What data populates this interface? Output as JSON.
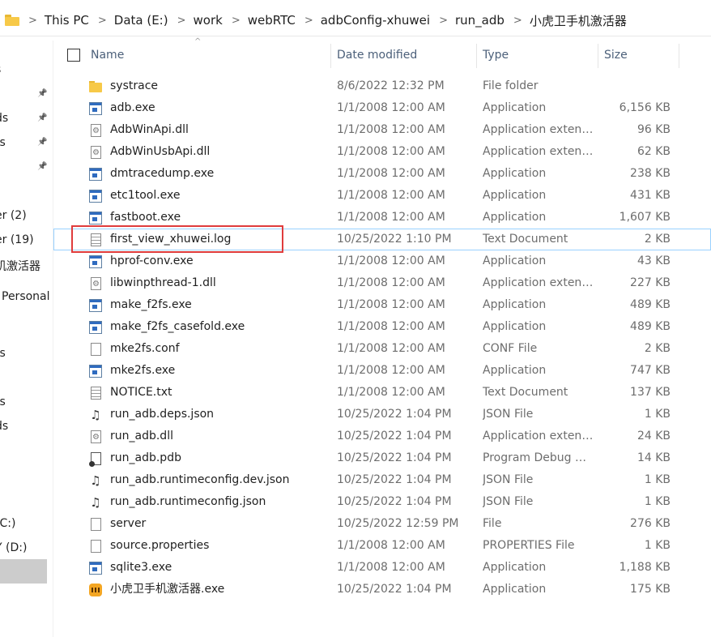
{
  "breadcrumb": [
    "This PC",
    "Data (E:)",
    "work",
    "webRTC",
    "adbConfig-xhuwei",
    "run_adb",
    "小虎卫手机激活器"
  ],
  "nav_items": [
    "s",
    "ds",
    "ts",
    "",
    "er (2)",
    "er (19)",
    "机激活器",
    "Personal",
    "ts",
    "ts",
    "ds",
    "(C:)",
    "Y (D:)",
    ""
  ],
  "columns": {
    "name": "Name",
    "date": "Date modified",
    "type": "Type",
    "size": "Size"
  },
  "files": [
    {
      "name": "systrace",
      "date": "8/6/2022 12:32 PM",
      "type": "File folder",
      "size": "",
      "icon": "folder-icon"
    },
    {
      "name": "adb.exe",
      "date": "1/1/2008 12:00 AM",
      "type": "Application",
      "size": "6,156 KB",
      "icon": "application-icon"
    },
    {
      "name": "AdbWinApi.dll",
      "date": "1/1/2008 12:00 AM",
      "type": "Application extens...",
      "size": "96 KB",
      "icon": "dll-icon"
    },
    {
      "name": "AdbWinUsbApi.dll",
      "date": "1/1/2008 12:00 AM",
      "type": "Application extens...",
      "size": "62 KB",
      "icon": "dll-icon"
    },
    {
      "name": "dmtracedump.exe",
      "date": "1/1/2008 12:00 AM",
      "type": "Application",
      "size": "238 KB",
      "icon": "application-icon"
    },
    {
      "name": "etc1tool.exe",
      "date": "1/1/2008 12:00 AM",
      "type": "Application",
      "size": "431 KB",
      "icon": "application-icon"
    },
    {
      "name": "fastboot.exe",
      "date": "1/1/2008 12:00 AM",
      "type": "Application",
      "size": "1,607 KB",
      "icon": "application-icon"
    },
    {
      "name": "first_view_xhuwei.log",
      "date": "10/25/2022 1:10 PM",
      "type": "Text Document",
      "size": "2 KB",
      "icon": "text-document-icon"
    },
    {
      "name": "hprof-conv.exe",
      "date": "1/1/2008 12:00 AM",
      "type": "Application",
      "size": "43 KB",
      "icon": "application-icon"
    },
    {
      "name": "libwinpthread-1.dll",
      "date": "1/1/2008 12:00 AM",
      "type": "Application extens...",
      "size": "227 KB",
      "icon": "dll-icon"
    },
    {
      "name": "make_f2fs.exe",
      "date": "1/1/2008 12:00 AM",
      "type": "Application",
      "size": "489 KB",
      "icon": "application-icon"
    },
    {
      "name": "make_f2fs_casefold.exe",
      "date": "1/1/2008 12:00 AM",
      "type": "Application",
      "size": "489 KB",
      "icon": "application-icon"
    },
    {
      "name": "mke2fs.conf",
      "date": "1/1/2008 12:00 AM",
      "type": "CONF File",
      "size": "2 KB",
      "icon": "file-icon"
    },
    {
      "name": "mke2fs.exe",
      "date": "1/1/2008 12:00 AM",
      "type": "Application",
      "size": "747 KB",
      "icon": "application-icon"
    },
    {
      "name": "NOTICE.txt",
      "date": "1/1/2008 12:00 AM",
      "type": "Text Document",
      "size": "137 KB",
      "icon": "text-document-icon"
    },
    {
      "name": "run_adb.deps.json",
      "date": "10/25/2022 1:04 PM",
      "type": "JSON File",
      "size": "1 KB",
      "icon": "json-icon"
    },
    {
      "name": "run_adb.dll",
      "date": "10/25/2022 1:04 PM",
      "type": "Application extens...",
      "size": "24 KB",
      "icon": "dll-icon"
    },
    {
      "name": "run_adb.pdb",
      "date": "10/25/2022 1:04 PM",
      "type": "Program Debug D...",
      "size": "14 KB",
      "icon": "pdb-icon"
    },
    {
      "name": "run_adb.runtimeconfig.dev.json",
      "date": "10/25/2022 1:04 PM",
      "type": "JSON File",
      "size": "1 KB",
      "icon": "json-icon"
    },
    {
      "name": "run_adb.runtimeconfig.json",
      "date": "10/25/2022 1:04 PM",
      "type": "JSON File",
      "size": "1 KB",
      "icon": "json-icon"
    },
    {
      "name": "server",
      "date": "10/25/2022 12:59 PM",
      "type": "File",
      "size": "276 KB",
      "icon": "file-icon"
    },
    {
      "name": "source.properties",
      "date": "1/1/2008 12:00 AM",
      "type": "PROPERTIES File",
      "size": "1 KB",
      "icon": "file-icon"
    },
    {
      "name": "sqlite3.exe",
      "date": "1/1/2008 12:00 AM",
      "type": "Application",
      "size": "1,188 KB",
      "icon": "application-icon"
    },
    {
      "name": "小虎卫手机激活器.exe",
      "date": "10/25/2022 1:04 PM",
      "type": "Application",
      "size": "175 KB",
      "icon": "tiger-app-icon"
    }
  ],
  "highlighted_file": "first_view_xhuwei.log",
  "colors": {
    "highlight_box": "#e03c3c",
    "selection_outline": "#99d1ff",
    "header_text": "#4c607a"
  }
}
